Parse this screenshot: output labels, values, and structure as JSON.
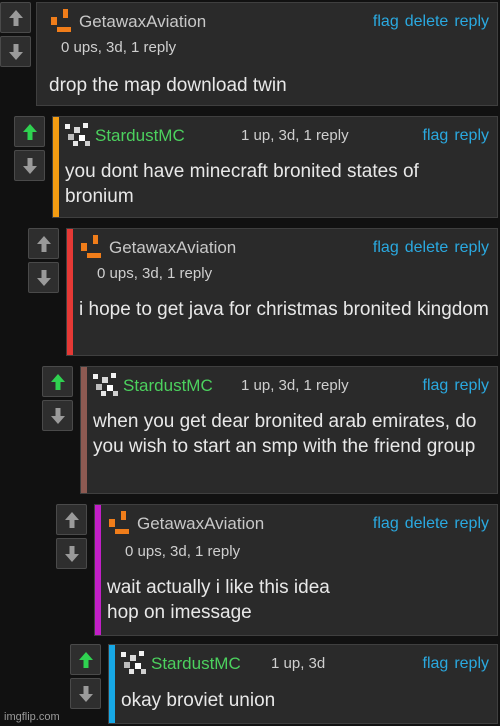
{
  "comments": [
    {
      "username": "GetawaxAviation",
      "meta": "0 ups, 3d, 1 reply",
      "text": "drop the map download twin",
      "actions": [
        "flag",
        "delete",
        "reply"
      ],
      "bar_color": "",
      "upvoted": false,
      "user_color": "#c8c8c8",
      "avatar": "orange"
    },
    {
      "username": "StardustMC",
      "meta": "1 up, 3d, 1 reply",
      "text": "you dont have minecraft bronited states of bronium",
      "actions": [
        "flag",
        "reply"
      ],
      "bar_color": "#f39c12",
      "upvoted": true,
      "user_color": "#4cd15e",
      "avatar": "white"
    },
    {
      "username": "GetawaxAviation",
      "meta": "0 ups, 3d, 1 reply",
      "text": "i hope to get java for christmas bronited kingdom",
      "actions": [
        "flag",
        "delete",
        "reply"
      ],
      "bar_color": "#e53935",
      "upvoted": false,
      "user_color": "#c8c8c8",
      "avatar": "orange"
    },
    {
      "username": "StardustMC",
      "meta": "1 up, 3d, 1 reply",
      "text": "when you get dear bronited arab emirates, do you wish to start an smp with the friend group",
      "actions": [
        "flag",
        "reply"
      ],
      "bar_color": "#8d5a52",
      "upvoted": true,
      "user_color": "#4cd15e",
      "avatar": "white"
    },
    {
      "username": "GetawaxAviation",
      "meta": "0 ups, 3d, 1 reply",
      "text": "wait actually i like this idea\nhop on imessage",
      "actions": [
        "flag",
        "delete",
        "reply"
      ],
      "bar_color": "#c21fc7",
      "upvoted": false,
      "user_color": "#c8c8c8",
      "avatar": "orange"
    },
    {
      "username": "StardustMC",
      "meta": "1 up, 3d",
      "text": "okay broviet union",
      "actions": [
        "flag",
        "reply"
      ],
      "bar_color": "#17a8e6",
      "upvoted": true,
      "user_color": "#4cd15e",
      "avatar": "white"
    }
  ],
  "watermark": "imgflip.com",
  "icons": {
    "up": "upvote-arrow-icon",
    "down": "downvote-arrow-icon"
  }
}
